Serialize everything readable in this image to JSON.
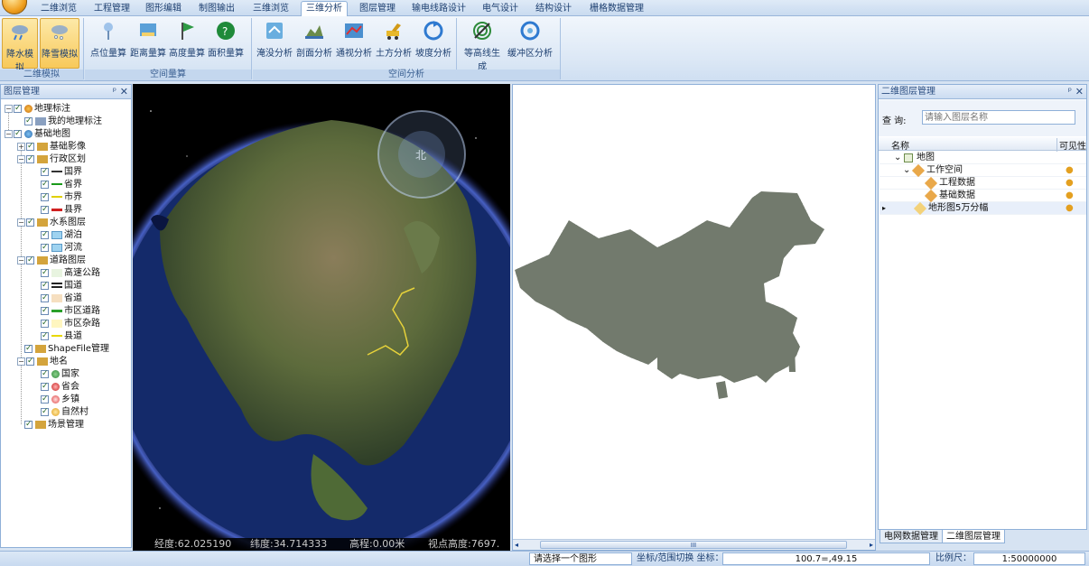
{
  "tabs": [
    "二维浏览",
    "工程管理",
    "图形编辑",
    "制图输出",
    "三维浏览",
    "三维分析",
    "图层管理",
    "输电线路设计",
    "电气设计",
    "结构设计",
    "栅格数据管理"
  ],
  "active_tab": "三维分析",
  "ribbon": {
    "buttons": [
      "降水模拟",
      "降雪模拟",
      "点位量算",
      "距离量算",
      "高度量算",
      "面积量算",
      "淹没分析",
      "剖面分析",
      "通视分析",
      "土方分析",
      "坡度分析",
      "等高线生成",
      "缓冲区分析"
    ],
    "groups": [
      "二维模拟",
      "空间量算",
      "空间分析"
    ]
  },
  "left_panel": {
    "title": "图层管理",
    "tree": [
      "地理标注",
      "我的地理标注",
      "基础地图",
      "基础影像",
      "行政区划",
      "国界",
      "省界",
      "市界",
      "县界",
      "水系图层",
      "湖泊",
      "河流",
      "道路图层",
      "高速公路",
      "国道",
      "省道",
      "市区道路",
      "市区杂路",
      "县道",
      "ShapeFile管理",
      "地名",
      "国家",
      "省会",
      "乡镇",
      "自然村",
      "场景管理"
    ]
  },
  "globe_status": {
    "lon": "经度:62.025190",
    "lat": "纬度:34.714333",
    "elev": "高程:0.00米",
    "view": "视点高度:7697."
  },
  "globe_compass": "北",
  "right_panel": {
    "title": "二维图层管理",
    "query_label": "查 询:",
    "query_placeholder": "请输入图层名称",
    "col_name": "名称",
    "col_visible": "可见性",
    "rows": [
      "地图",
      "工作空间",
      "工程数据",
      "基础数据",
      "地形图5万分幅"
    ],
    "bottom_tabs": [
      "电网数据管理",
      "二维图层管理"
    ]
  },
  "map_scroll_label": "III",
  "statusbar": {
    "selected": "请选择一个图形",
    "coord_label": "坐标/范围切换 坐标：",
    "coord": "100.7=,49.15",
    "scale_label": "比例尺：",
    "scale": "1:50000000"
  },
  "colors": {
    "ribbon_bg": "#dbe7f5",
    "accent": "#f8c95a",
    "china_fill": "#7c8478",
    "panel_border": "#8fb0d8"
  }
}
